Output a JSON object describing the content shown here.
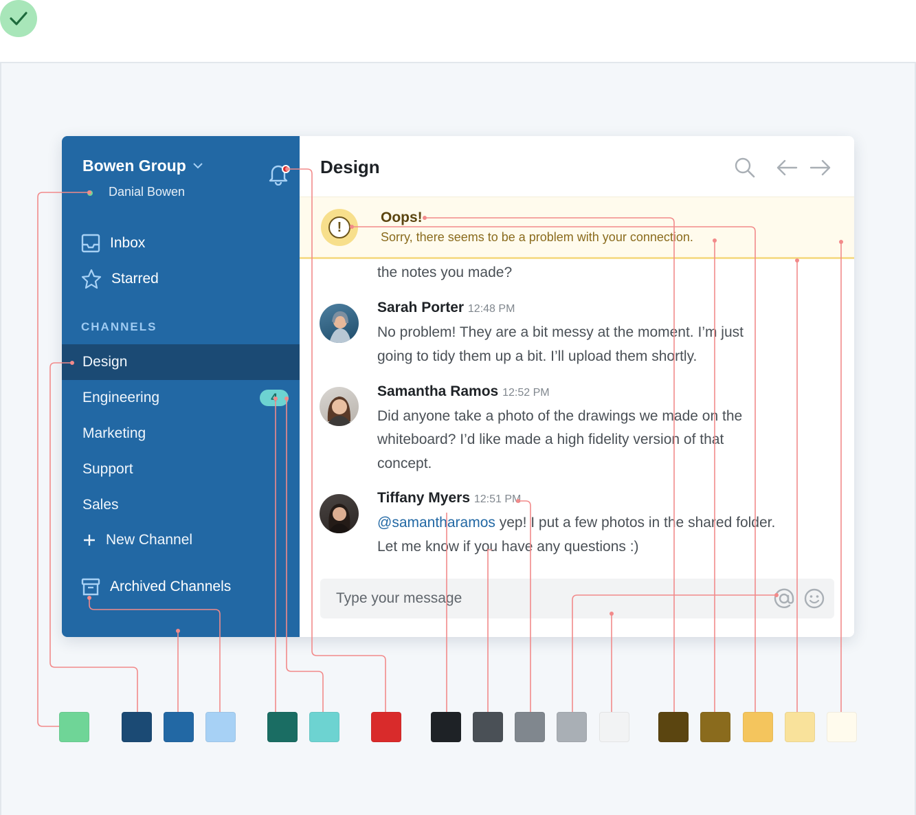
{
  "sidebar": {
    "org_name": "Bowen Group",
    "user_name": "Danial Bowen",
    "nav": [
      {
        "label": "Inbox",
        "icon": "inbox-icon"
      },
      {
        "label": "Starred",
        "icon": "star-icon"
      }
    ],
    "channels_label": "CHANNELS",
    "channels": [
      {
        "label": "Design",
        "active": true
      },
      {
        "label": "Engineering",
        "badge": "4"
      },
      {
        "label": "Marketing"
      },
      {
        "label": "Support"
      },
      {
        "label": "Sales"
      }
    ],
    "new_channel": "New Channel",
    "archived": "Archived Channels"
  },
  "main": {
    "title": "Design",
    "alert": {
      "title": "Oops!",
      "message": "Sorry, there seems to be a problem with your connection."
    },
    "messages": {
      "previous_tail": "the notes you made?",
      "m1": {
        "author": "Sarah Porter",
        "time": "12:48 PM",
        "line1": "No problem! They are a bit messy at the moment. I’m just",
        "line2": "going to tidy them up a bit. I’ll upload them shortly."
      },
      "m2": {
        "author": "Samantha Ramos",
        "time": "12:52 PM",
        "line1": "Did anyone take a photo of the drawings we made on the",
        "line2": "whiteboard? I’d like made a high fidelity version of that",
        "line3": "concept."
      },
      "m3": {
        "author": "Tiffany Myers",
        "time": "12:51 PM",
        "mention": "@samantharamos",
        "line1_rest": " yep! I put a few photos in the shared folder.",
        "line2": "Let me know if you have any questions :)"
      }
    },
    "composer_placeholder": "Type your message"
  },
  "palette": [
    "#6fd597",
    "#1b4a74",
    "#2268a4",
    "#a7d1f5",
    "#1a6d63",
    "#6dd3d1",
    "#d92b2b",
    "#1e2226",
    "#4a5056",
    "#80878e",
    "#a9afb5",
    "#f2f3f4",
    "#5b4510",
    "#8a6b1d",
    "#f4c55d",
    "#f9e29b",
    "#fffbed"
  ],
  "colors": {
    "sidebar": "#2268a4",
    "active_channel": "#1b4a74",
    "alert_bg": "#fffbed",
    "annotation_line": "#f28a8a"
  }
}
